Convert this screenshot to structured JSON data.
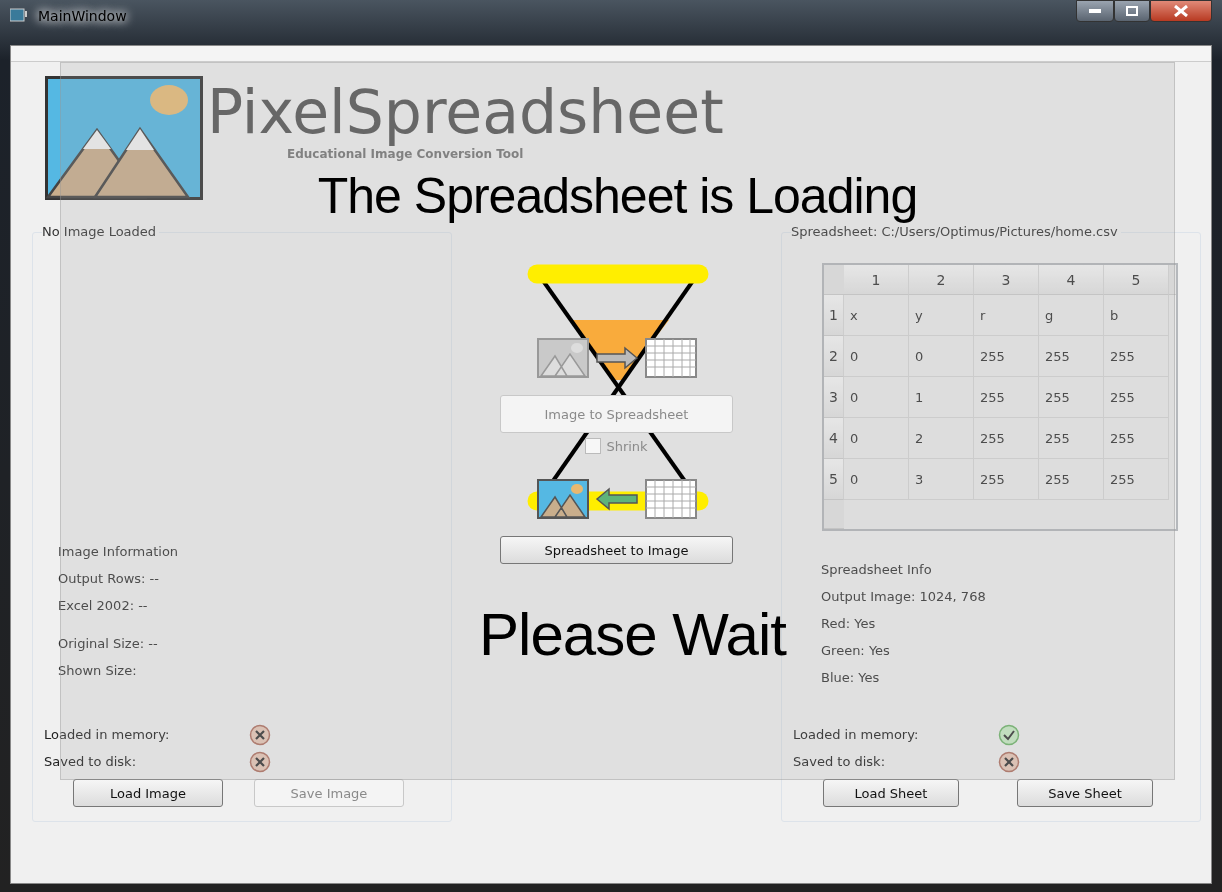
{
  "window": {
    "title": "MainWindow"
  },
  "header": {
    "title": "PixelSpreadsheet",
    "subtitle": "Educational Image Conversion Tool"
  },
  "image_panel": {
    "title": "No Image Loaded",
    "info_groups": [
      [
        "Image Information",
        "Output Rows: --",
        "Excel 2002: --"
      ],
      [
        "Original Size: --",
        "Shown Size:"
      ]
    ],
    "status": [
      {
        "label": "Loaded in memory:",
        "ok": false
      },
      {
        "label": "Saved to disk:",
        "ok": false
      }
    ],
    "buttons": [
      {
        "label": "Load Image",
        "disabled": false
      },
      {
        "label": "Save Image",
        "disabled": true
      }
    ]
  },
  "converter": {
    "to_sheet_button": {
      "label": "Image to Spreadsheet",
      "disabled": true
    },
    "shrink": {
      "label": "Shrink",
      "checked": false,
      "disabled": true
    },
    "to_image_button": {
      "label": "Spreadsheet to Image",
      "disabled": false
    }
  },
  "sheet_panel": {
    "title": "Spreadsheet: C:/Users/Optimus/Pictures/home.csv",
    "table": {
      "columns": [
        "1",
        "2",
        "3",
        "4",
        "5"
      ],
      "rows": [
        {
          "header": "1",
          "cells": [
            "x",
            "y",
            "r",
            "g",
            "b"
          ]
        },
        {
          "header": "2",
          "cells": [
            "0",
            "0",
            "255",
            "255",
            "255"
          ]
        },
        {
          "header": "3",
          "cells": [
            "0",
            "1",
            "255",
            "255",
            "255"
          ]
        },
        {
          "header": "4",
          "cells": [
            "0",
            "2",
            "255",
            "255",
            "255"
          ]
        },
        {
          "header": "5",
          "cells": [
            "0",
            "3",
            "255",
            "255",
            "255"
          ]
        }
      ]
    },
    "info_groups": [
      [
        "Spreadsheet Info",
        "Output Image: 1024, 768",
        "Red: Yes",
        "Green: Yes",
        "Blue: Yes"
      ]
    ],
    "status": [
      {
        "label": "Loaded in memory:",
        "ok": true
      },
      {
        "label": "Saved to disk:",
        "ok": false
      }
    ],
    "buttons": [
      {
        "label": "Load Sheet",
        "disabled": false
      },
      {
        "label": "Save Sheet",
        "disabled": false
      }
    ]
  },
  "overlay": {
    "title": "The Spreadsheet is Loading",
    "message": "Please Wait"
  }
}
